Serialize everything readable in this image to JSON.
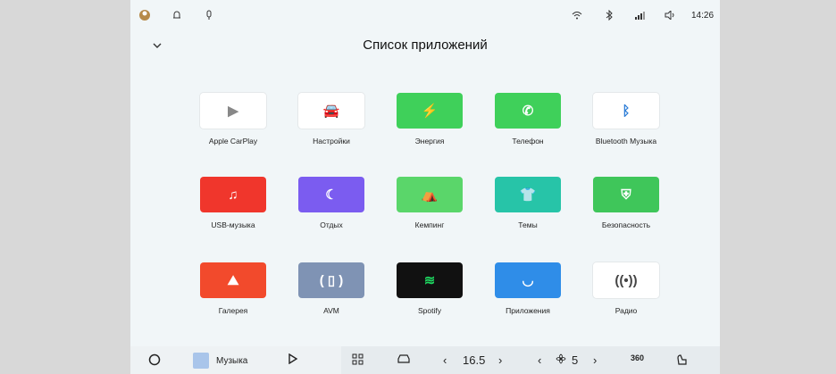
{
  "status": {
    "time": "14:26",
    "left_icons": [
      "avatar-icon",
      "bell-icon",
      "mic-icon"
    ],
    "right_icons": [
      "wifi-icon",
      "bluetooth-icon",
      "signal-icon",
      "volume-icon"
    ]
  },
  "header": {
    "title": "Список приложений",
    "collapse_icon": "chevron-down-icon"
  },
  "apps": [
    {
      "label": "Apple CarPlay",
      "icon": "carplay-icon",
      "bg": "#ffffff",
      "fg": "#888888",
      "glyph": "▶"
    },
    {
      "label": "Настройки",
      "icon": "car-settings-icon",
      "bg": "#ffffff",
      "fg": "#555555",
      "glyph": "🚘"
    },
    {
      "label": "Энергия",
      "icon": "energy-icon",
      "bg": "#3fd05a",
      "fg": "#ffffff",
      "glyph": "⚡"
    },
    {
      "label": "Телефон",
      "icon": "phone-icon",
      "bg": "#3fd05a",
      "fg": "#ffffff",
      "glyph": "✆"
    },
    {
      "label": "Bluetooth Музыка",
      "icon": "bluetooth-music-icon",
      "bg": "#ffffff",
      "fg": "#2a7bd6",
      "glyph": "ᛒ"
    },
    {
      "label": "USB-музыка",
      "icon": "usb-icon",
      "bg": "#f0362c",
      "fg": "#ffffff",
      "glyph": "♫"
    },
    {
      "label": "Отдых",
      "icon": "rest-icon",
      "bg": "#7b5cf0",
      "fg": "#ffffff",
      "glyph": "☾"
    },
    {
      "label": "Кемпинг",
      "icon": "camping-icon",
      "bg": "#5ad66a",
      "fg": "#ffffff",
      "glyph": "⛺"
    },
    {
      "label": "Темы",
      "icon": "themes-icon",
      "bg": "#27c4a8",
      "fg": "#ffffff",
      "glyph": "👕"
    },
    {
      "label": "Безопасность",
      "icon": "security-icon",
      "bg": "#3fc65a",
      "fg": "#ffffff",
      "glyph": "⛨"
    },
    {
      "label": "Галерея",
      "icon": "gallery-icon",
      "bg": "#f24a2c",
      "fg": "#ffffff",
      "glyph": "⛰"
    },
    {
      "label": "AVM",
      "icon": "avm-icon",
      "bg": "#7f93b4",
      "fg": "#ffffff",
      "glyph": "( ▯ )"
    },
    {
      "label": "Spotify",
      "icon": "spotify-icon",
      "bg": "#111111",
      "fg": "#1ed760",
      "glyph": "≋"
    },
    {
      "label": "Приложения",
      "icon": "apps-store-icon",
      "bg": "#2f8de8",
      "fg": "#ffffff",
      "glyph": "◡"
    },
    {
      "label": "Радио",
      "icon": "radio-icon",
      "bg": "#ffffff",
      "fg": "#444444",
      "glyph": "((•))"
    }
  ],
  "dock": {
    "home_icon": "home-icon",
    "music_label": "Музыка",
    "play_icon": "play-icon",
    "apps_icon": "apps-grid-icon",
    "car_icon": "car-icon",
    "temp_value": "16.5",
    "fan_value": "5",
    "view360_label": "360",
    "seat_icon": "seat-heat-icon"
  }
}
